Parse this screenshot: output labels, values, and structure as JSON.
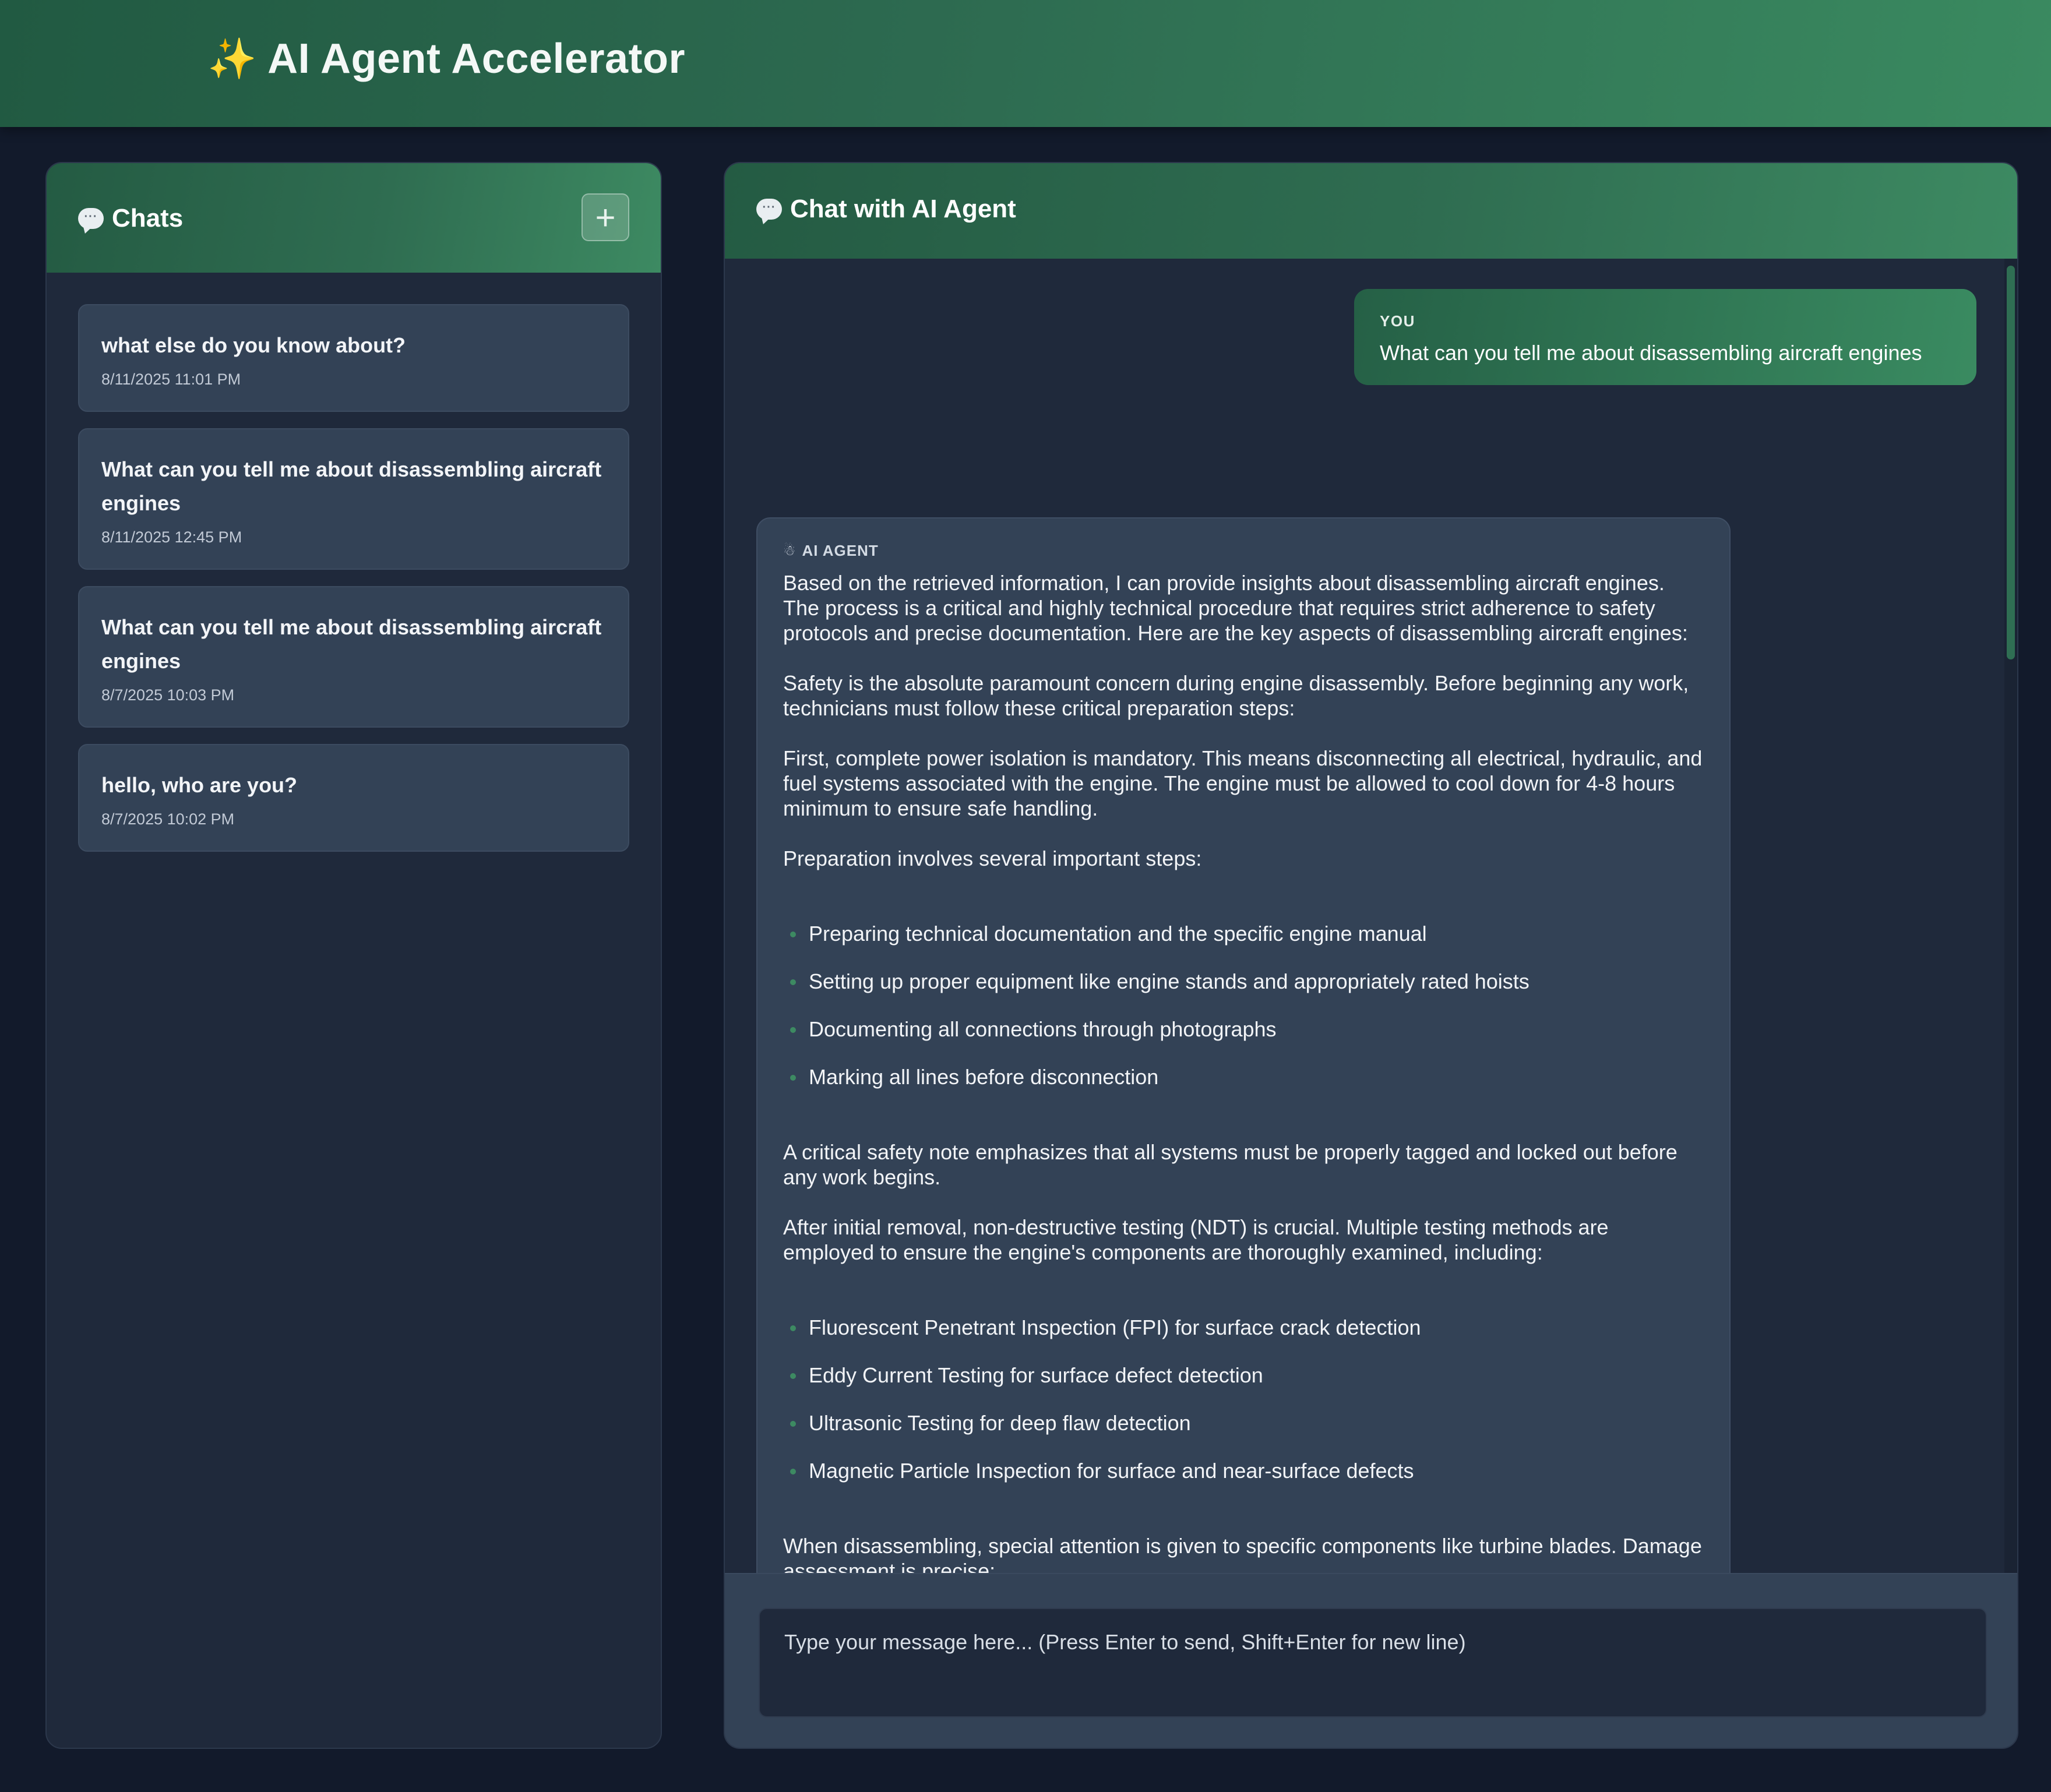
{
  "app": {
    "title": "AI Agent Accelerator",
    "title_icon": "sparkles-icon"
  },
  "sidebar": {
    "title": "Chats",
    "title_icon": "chat-bubble-icon",
    "new_chat_icon": "plus-icon",
    "chats": [
      {
        "title": "what else do you know about?",
        "date": "8/11/2025 11:01 PM"
      },
      {
        "title": "What can you tell me about disassembling aircraft engines",
        "date": "8/11/2025 12:45 PM"
      },
      {
        "title": "What can you tell me about disassembling aircraft engines",
        "date": "8/7/2025 10:03 PM"
      },
      {
        "title": "hello, who are you?",
        "date": "8/7/2025 10:02 PM"
      }
    ]
  },
  "main": {
    "title": "Chat with AI Agent",
    "title_icon": "chat-bubble-icon",
    "messages": {
      "user": {
        "role": "YOU",
        "text": "What can you tell me about disassembling aircraft engines"
      },
      "agent": {
        "role": "AI AGENT",
        "role_icon": "robot-icon",
        "p1": "Based on the retrieved information, I can provide insights about disassembling aircraft engines. The process is a critical and highly technical procedure that requires strict adherence to safety protocols and precise documentation. Here are the key aspects of disassembling aircraft engines:",
        "p2": "Safety is the absolute paramount concern during engine disassembly. Before beginning any work, technicians must follow these critical preparation steps:",
        "p3": "First, complete power isolation is mandatory. This means disconnecting all electrical, hydraulic, and fuel systems associated with the engine. The engine must be allowed to cool down for 4-8 hours minimum to ensure safe handling.",
        "p4": "Preparation involves several important steps:",
        "list1": [
          "Preparing technical documentation and the specific engine manual",
          "Setting up proper equipment like engine stands and appropriately rated hoists",
          "Documenting all connections through photographs",
          "Marking all lines before disconnection"
        ],
        "p5": "A critical safety note emphasizes that all systems must be properly tagged and locked out before any work begins.",
        "p6": "After initial removal, non-destructive testing (NDT) is crucial. Multiple testing methods are employed to ensure the engine's components are thoroughly examined, including:",
        "list2": [
          "Fluorescent Penetrant Inspection (FPI) for surface crack detection",
          "Eddy Current Testing for surface defect detection",
          "Ultrasonic Testing for deep flaw detection",
          "Magnetic Particle Inspection for surface and near-surface defects"
        ],
        "p7": "When disassembling, special attention is given to specific components like turbine blades. Damage assessment is precise:"
      }
    },
    "composer": {
      "placeholder": "Type your message here... (Press Enter to send, Shift+Enter for new line)",
      "value": ""
    }
  },
  "colors": {
    "accent": "#3a8a60",
    "header_dark": "#215a42",
    "background": "#121a2b",
    "panel": "#1f293b",
    "card": "#334256"
  }
}
